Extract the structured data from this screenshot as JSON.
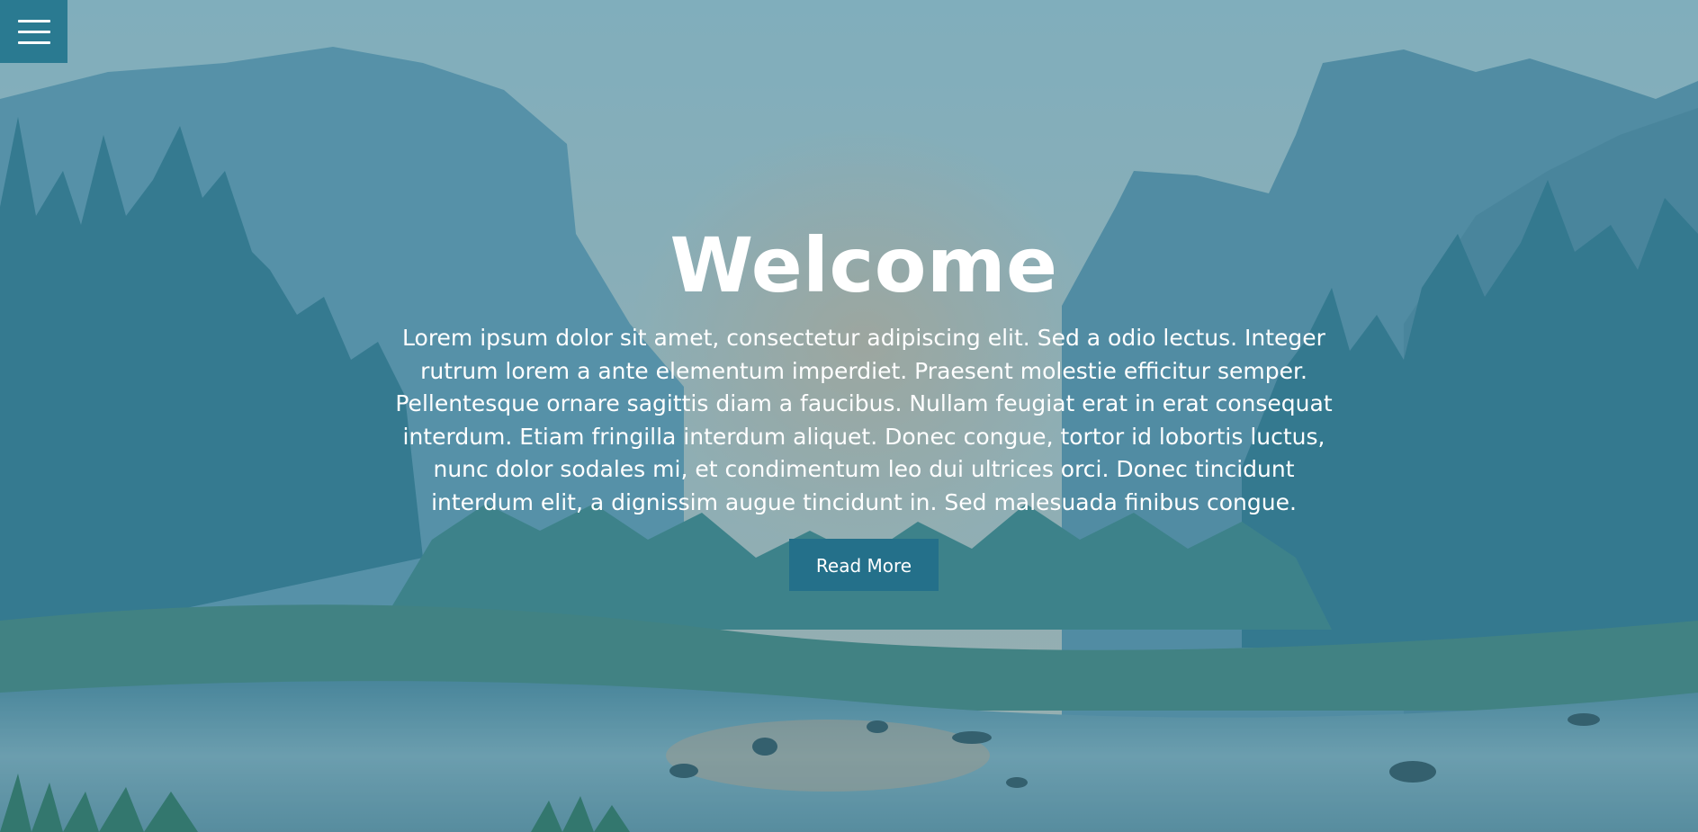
{
  "menu": {
    "icon": "hamburger-menu-icon"
  },
  "hero": {
    "title": "Welcome",
    "description": "Lorem ipsum dolor sit amet, consectetur adipiscing elit. Sed a odio lectus. Integer rutrum lorem a ante elementum imperdiet. Praesent molestie efficitur semper. Pellentesque ornare sagittis diam a faucibus. Nullam feugiat erat in erat consequat interdum. Etiam fringilla interdum aliquet. Donec congue, tortor id lobortis luctus, nunc dolor sodales mi, et condimentum leo dui ultrices orci. Donec tincidunt interdum elit, a dignissim augue tincidunt in. Sed malesuada finibus congue.",
    "button_label": "Read More"
  },
  "colors": {
    "accent": "#2a7a91",
    "button": "#24708a",
    "text": "#ffffff"
  }
}
